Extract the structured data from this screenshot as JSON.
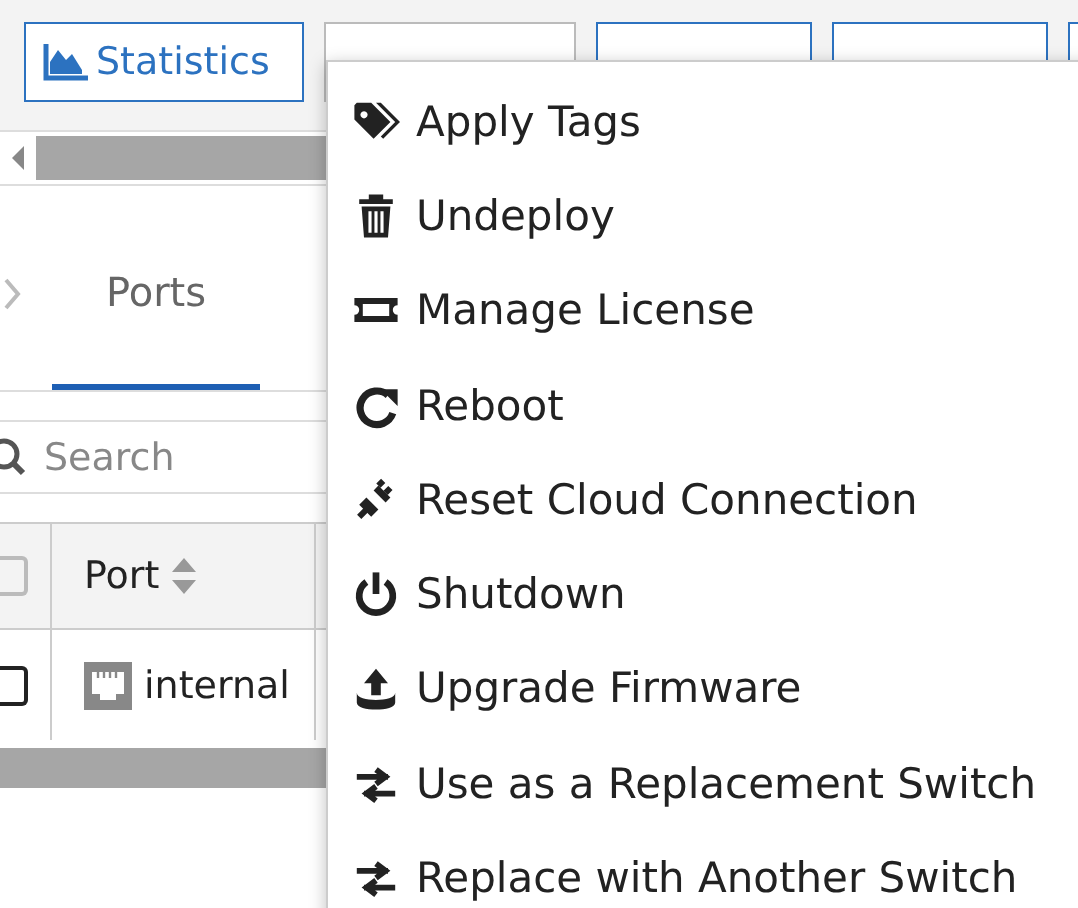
{
  "toolbar": {
    "buttons": [
      {
        "label": "Statistics",
        "kind": "stats"
      },
      {
        "kind": "plain"
      },
      {
        "kind": "primary"
      },
      {
        "kind": "primary"
      }
    ]
  },
  "tabs": [
    {
      "label": "Ports",
      "selected": true
    }
  ],
  "search": {
    "placeholder": "Search"
  },
  "table": {
    "select_all": {
      "checked": false
    },
    "columns": [
      "Port"
    ],
    "rows": [
      {
        "checked": false,
        "port": "internal"
      }
    ]
  },
  "menu": {
    "items": [
      {
        "label": "Apply Tags",
        "kind": "tags"
      },
      {
        "label": "Undeploy",
        "kind": "trash"
      },
      {
        "label": "Manage License",
        "kind": "ticket"
      },
      {
        "label": "Reboot",
        "kind": "redo"
      },
      {
        "label": "Reset Cloud Connection",
        "kind": "plug"
      },
      {
        "label": "Shutdown",
        "kind": "power"
      },
      {
        "label": "Upgrade Firmware",
        "kind": "upload"
      },
      {
        "label": "Use as a Replacement Switch",
        "kind": "swap"
      },
      {
        "label": "Replace with Another Switch",
        "kind": "swap"
      }
    ]
  }
}
